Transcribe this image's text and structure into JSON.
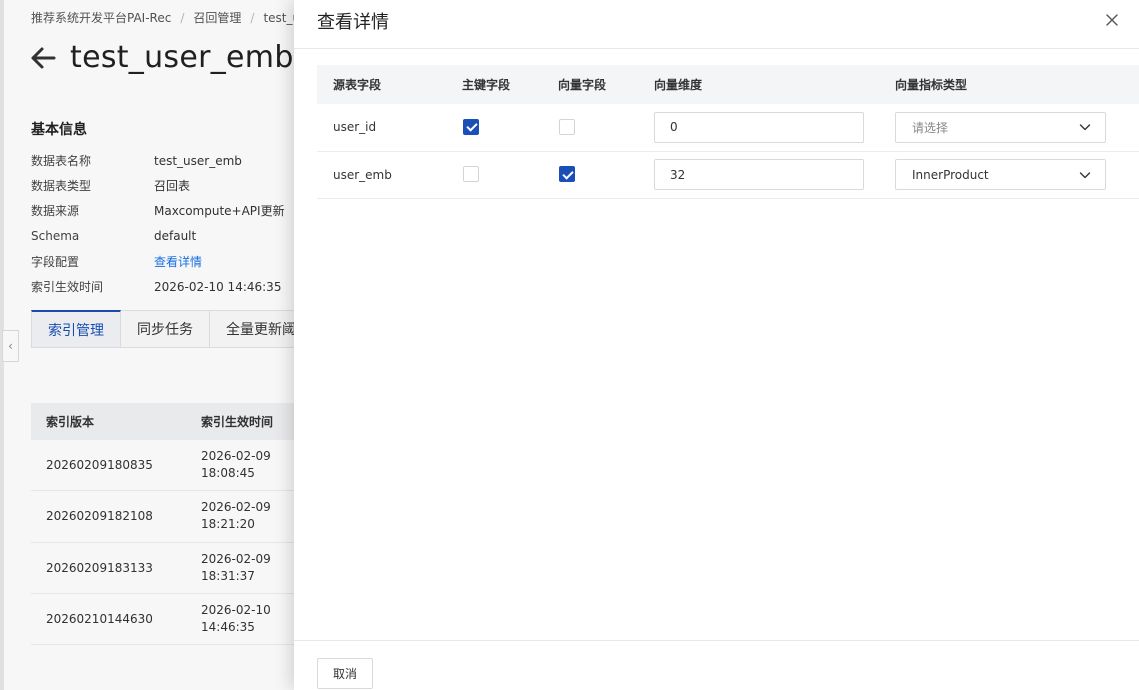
{
  "breadcrumb": {
    "items": [
      "推荐系统开发平台PAI-Rec",
      "召回管理",
      "test_us"
    ],
    "separator": "/"
  },
  "page": {
    "title": "test_user_emb",
    "back_icon": "arrow-left-icon"
  },
  "basic_info": {
    "section_title": "基本信息",
    "rows": [
      {
        "label": "数据表名称",
        "value": "test_user_emb"
      },
      {
        "label": "数据表类型",
        "value": "召回表"
      },
      {
        "label": "数据来源",
        "value": "Maxcompute+API更新"
      },
      {
        "label": "Schema",
        "value": "default"
      },
      {
        "label": "字段配置",
        "value": "查看详情"
      },
      {
        "label": "索引生效时间",
        "value": "2026-02-10 14:46:35"
      }
    ]
  },
  "tabs": {
    "items": [
      "索引管理",
      "同步任务",
      "全量更新阈值"
    ],
    "active": 0
  },
  "index_table": {
    "headers": [
      "索引版本",
      "索引生效时间"
    ],
    "rows": [
      {
        "version": "20260209180835",
        "time_date": "2026-02-09",
        "time_clock": "18:08:45"
      },
      {
        "version": "20260209182108",
        "time_date": "2026-02-09",
        "time_clock": "18:21:20"
      },
      {
        "version": "20260209183133",
        "time_date": "2026-02-09",
        "time_clock": "18:31:37"
      },
      {
        "version": "20260210144630",
        "time_date": "2026-02-10",
        "time_clock": "14:46:35"
      }
    ]
  },
  "drawer": {
    "title": "查看详情",
    "close_icon": "close-icon",
    "table": {
      "headers": [
        "源表字段",
        "主键字段",
        "向量字段",
        "向量维度",
        "向量指标类型"
      ],
      "rows": [
        {
          "source_field": "user_id",
          "primary_key": true,
          "vector_field": false,
          "dimension": "0",
          "metric_type": "",
          "metric_placeholder": "请选择"
        },
        {
          "source_field": "user_emb",
          "primary_key": false,
          "vector_field": true,
          "dimension": "32",
          "metric_type": "InnerProduct",
          "metric_placeholder": ""
        }
      ]
    },
    "cancel_label": "取消"
  },
  "colors": {
    "accent": "#1a4fb8",
    "link": "#1a73e8"
  }
}
